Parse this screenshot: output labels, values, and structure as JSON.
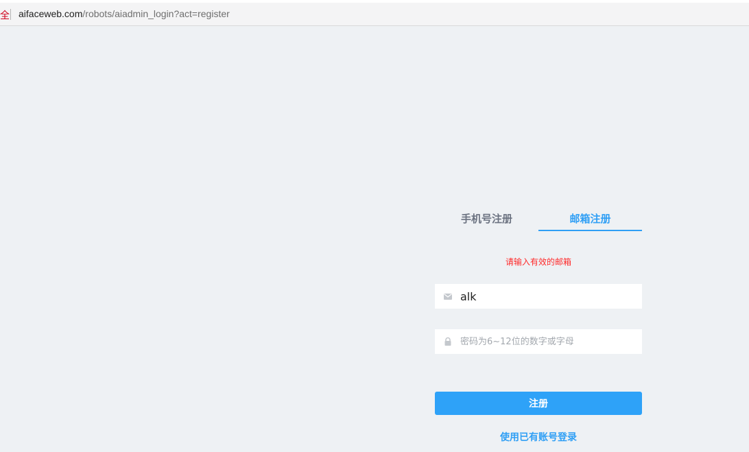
{
  "browser": {
    "security_fragment": "全",
    "url_host": "aifaceweb.com",
    "url_path": "/robots/aiadmin_login?act=register"
  },
  "register": {
    "tabs": [
      {
        "label": "手机号注册",
        "active": false
      },
      {
        "label": "邮箱注册",
        "active": true
      }
    ],
    "error_message": "请输入有效的邮箱",
    "email": {
      "value": "alk",
      "icon": "mail-icon"
    },
    "password": {
      "placeholder": "密码为6~12位的数字或字母",
      "value": "",
      "icon": "lock-icon"
    },
    "submit_label": "注册",
    "login_link": "使用已有账号登录"
  },
  "colors": {
    "accent": "#2ea2f8",
    "error": "#ff2a2a",
    "background": "#eef1f4"
  }
}
